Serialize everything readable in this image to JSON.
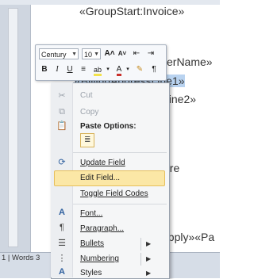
{
  "document": {
    "field_group_invoice": "«GroupStart:Invoice»",
    "field_customer": "erName»",
    "field_billing_line1": "«BillingAddressLine1»",
    "field_billing_line2": "Line2»",
    "text_ere": "ere",
    "field_supply": "upply»«Pa"
  },
  "status_bar": {
    "text": "1 | Words 3"
  },
  "mini_toolbar": {
    "font_name": "Century",
    "font_size": "10",
    "grow_font": "A˄",
    "shrink_font": "A˅",
    "bold": "B",
    "italic": "I",
    "underline": "U"
  },
  "context_menu": {
    "items": [
      {
        "label": "Cut",
        "icon": "scissors-icon",
        "enabled": false
      },
      {
        "label": "Copy",
        "icon": "copy-icon",
        "enabled": false
      },
      {
        "label": "Paste Options:",
        "icon": "paste-icon",
        "enabled": true
      },
      {
        "label": "Update Field",
        "icon": "update-field-icon",
        "enabled": true
      },
      {
        "label": "Edit Field...",
        "icon": "",
        "enabled": true,
        "highlighted": true
      },
      {
        "label": "Toggle Field Codes",
        "icon": "",
        "enabled": true
      },
      {
        "label": "Font...",
        "icon": "font-icon",
        "enabled": true
      },
      {
        "label": "Paragraph...",
        "icon": "paragraph-icon",
        "enabled": true
      },
      {
        "label": "Bullets",
        "icon": "bullets-icon",
        "enabled": true,
        "submenu": true
      },
      {
        "label": "Numbering",
        "icon": "numbering-icon",
        "enabled": true,
        "submenu": true
      },
      {
        "label": "Styles",
        "icon": "styles-icon",
        "enabled": true,
        "submenu": true
      }
    ]
  },
  "colors": {
    "highlight": "#fbe7a6",
    "highlight_border": "#e7bf5b",
    "menu_bg": "#f5f6f7"
  }
}
